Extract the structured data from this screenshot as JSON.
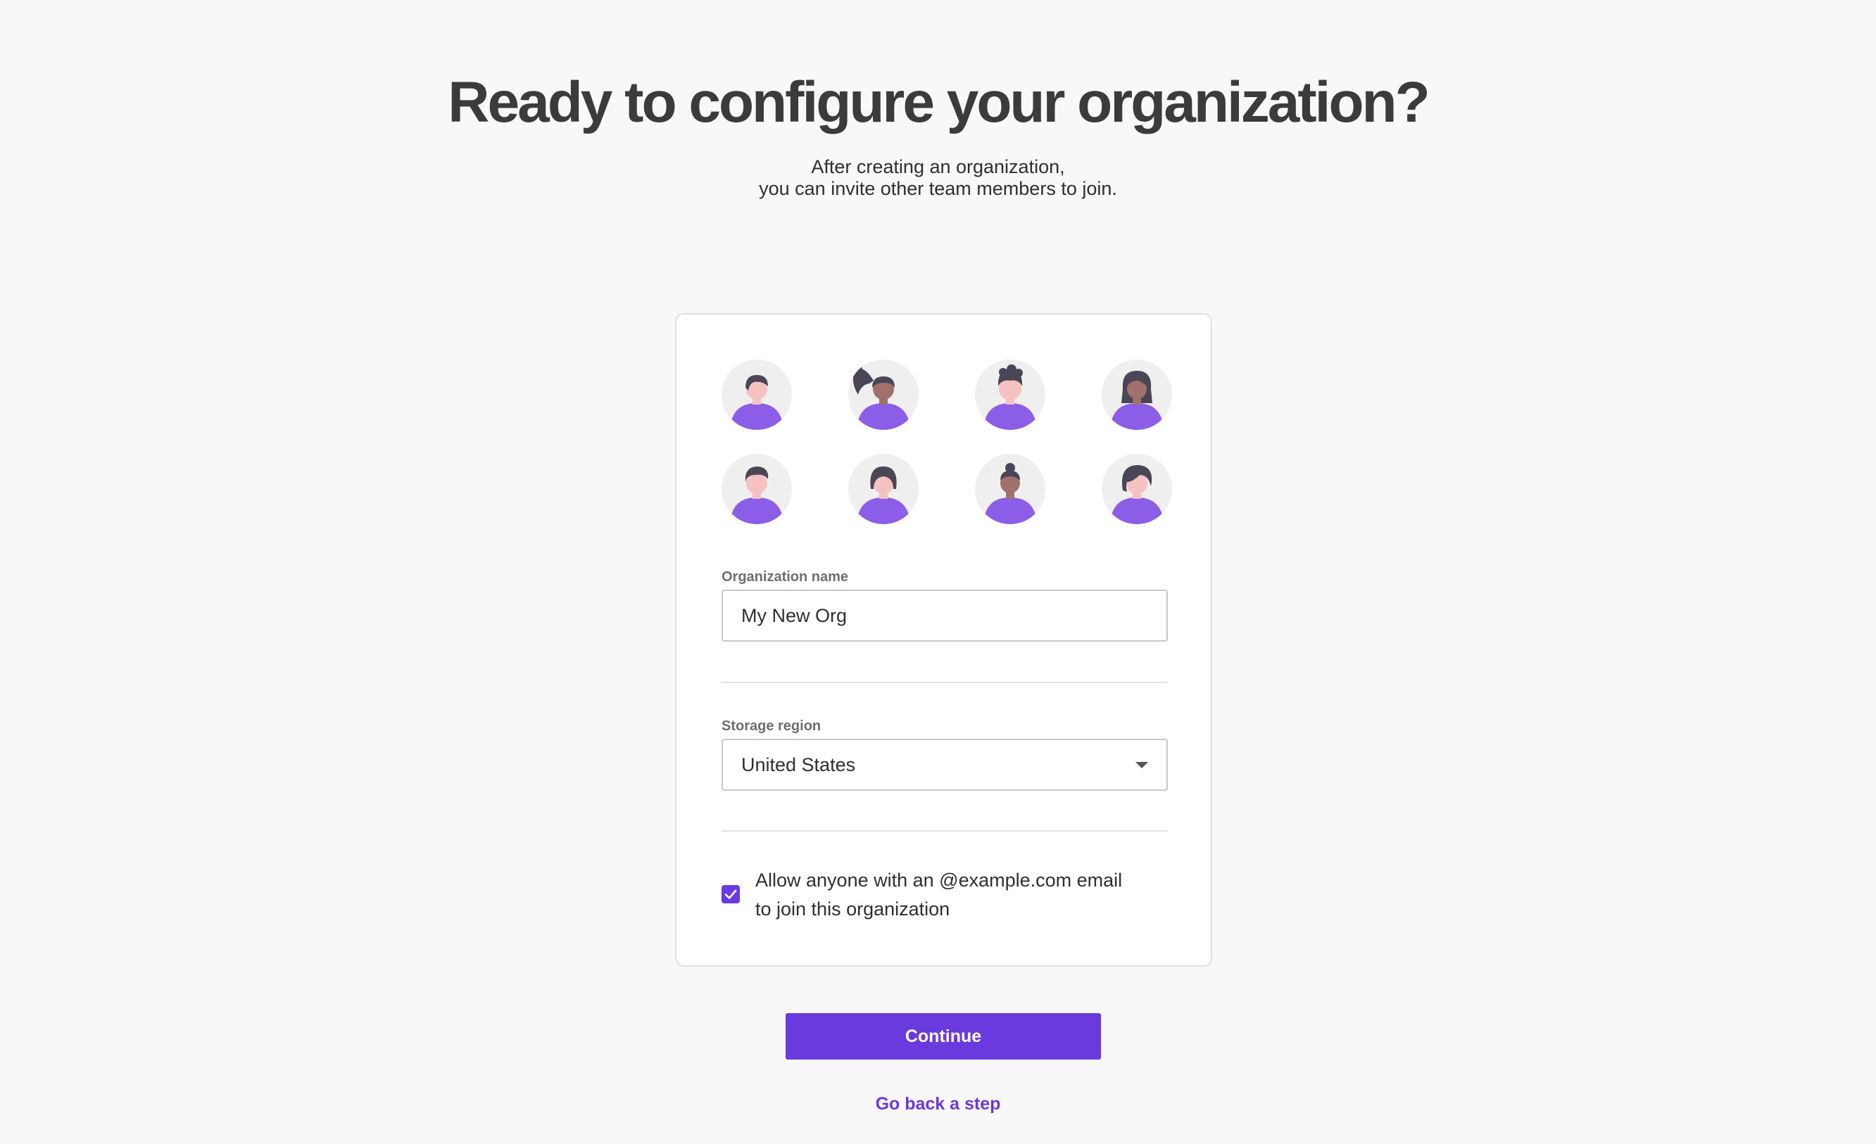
{
  "header": {
    "title": "Ready to configure your organization?",
    "subtitle_line1": "After creating an organization,",
    "subtitle_line2": "you can invite other team members to join."
  },
  "avatars": [
    {
      "icon": "person-avatar-icon",
      "hair": "short"
    },
    {
      "icon": "person-avatar-icon",
      "hair": "ponytail"
    },
    {
      "icon": "person-avatar-icon",
      "hair": "short-curly"
    },
    {
      "icon": "person-avatar-icon",
      "hair": "long"
    },
    {
      "icon": "person-avatar-icon",
      "hair": "short-side"
    },
    {
      "icon": "person-avatar-icon",
      "hair": "bob"
    },
    {
      "icon": "person-avatar-icon",
      "hair": "bun"
    },
    {
      "icon": "person-avatar-icon",
      "hair": "wavy"
    }
  ],
  "form": {
    "org_name_label": "Organization name",
    "org_name_value": "My New Org",
    "region_label": "Storage region",
    "region_value": "United States",
    "allow_domain_checked": true,
    "allow_domain_line1": "Allow anyone with an @example.com email",
    "allow_domain_line2": "to join this organization"
  },
  "actions": {
    "continue_label": "Continue",
    "back_label": "Go back a step"
  },
  "colors": {
    "accent": "#6b3adf",
    "avatar_shirt": "#8c5ee8",
    "avatar_hair": "#4a4656",
    "avatar_skin_light": "#f6c1c1",
    "avatar_skin_dark": "#a0716a",
    "background": "#f8f8f8"
  }
}
